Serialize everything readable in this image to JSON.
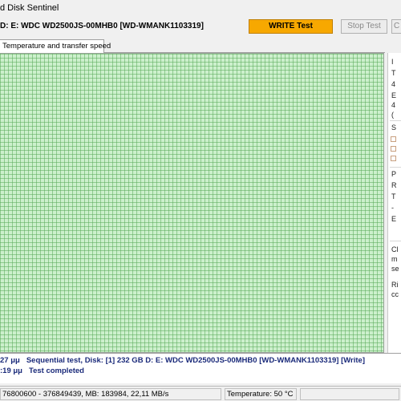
{
  "window": {
    "title": "d Disk Sentinel"
  },
  "toolbar": {
    "disk_label": "D: E: WDC WD2500JS-00MHB0 [WD-WMANK1103319]",
    "write_test_label": "WRITE Test",
    "stop_test_label": "Stop Test",
    "extra_button_label": "C"
  },
  "tabs": [
    {
      "label": "Temperature and transfer speed"
    }
  ],
  "side_panel": {
    "fragments": [
      "I",
      "T",
      "4",
      "E",
      "4",
      "(",
      "S",
      "P",
      "R",
      "T",
      "-",
      "E",
      "Cl",
      "m",
      "se",
      "Ri",
      "cc"
    ]
  },
  "log": {
    "lines": [
      {
        "time": "27 μμ",
        "text": "Sequential test, Disk: [1] 232 GB D: E: WDC WD2500JS-00MHB0 [WD-WMANK1103319] [Write]"
      },
      {
        "time": ":19 μμ",
        "text": "Test completed"
      }
    ]
  },
  "status_bar": {
    "progress_text": "76800600 - 376849439, MB: 183984, 22,11 MB/s",
    "temperature_text": "Temperature: 50  °C"
  },
  "colors": {
    "accent_write": "#f7a800",
    "grid_fill": "#ccf0cc",
    "grid_line": "#5aaa5a",
    "log_text": "#1a2a7a"
  }
}
